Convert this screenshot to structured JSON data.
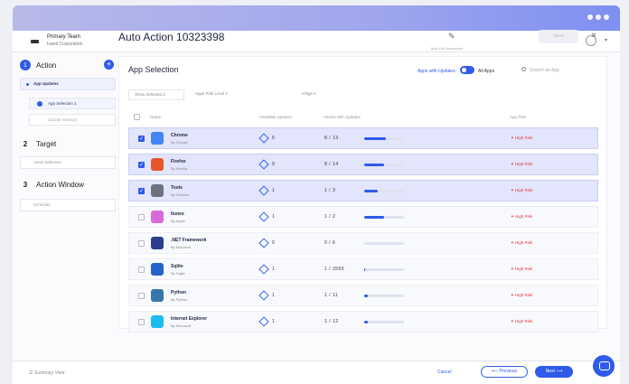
{
  "header": {
    "team_name": "Primary Team",
    "team_org": "Ivanti Corporation"
  },
  "sidebar": {
    "steps": [
      {
        "num": "1",
        "label": "Action"
      },
      {
        "num": "2",
        "label": "Target"
      },
      {
        "num": "3",
        "label": "Action Window"
      }
    ],
    "plus": "+",
    "sub_app_updates": "App Updates",
    "sub_app_selection": "App Selection 1",
    "sub_update_settings": "Update Settings",
    "sub_asset_selection": "Asset Selection",
    "sub_schedule": "Schedule"
  },
  "main": {
    "title": "Auto Action 10323398",
    "max_note": "Max 128 characters",
    "save_label": "Save",
    "close": "×"
  },
  "panel": {
    "title": "App Selection",
    "toggle_label": "Apps with Updates",
    "all_apps": "All Apps",
    "search_placeholder": "Search an App",
    "filters": {
      "show_selected": "Show Selected 3",
      "risk_level": "Apps Risk Level",
      "tags": "vTags"
    },
    "columns": {
      "name": "Name",
      "updates": "Available Updates",
      "assets": "Assets with Updates",
      "risk": "App Risk"
    }
  },
  "rows": [
    {
      "name": "Chrome",
      "by": "By Google",
      "updates": "5",
      "assets": "8  /  13",
      "fill": 0.55,
      "risk": "✦ High Risk",
      "selected": true,
      "color": "#4285f4"
    },
    {
      "name": "Firefox",
      "by": "By Mozilla",
      "updates": "9",
      "assets": "8  /  14",
      "fill": 0.5,
      "risk": "✦ High Risk",
      "selected": true,
      "color": "#e8562b"
    },
    {
      "name": "Tools",
      "by": "By Vmware",
      "updates": "1",
      "assets": "1  /  3",
      "fill": 0.35,
      "risk": "✦ High Risk",
      "selected": true,
      "color": "#6b7280"
    },
    {
      "name": "Itunes",
      "by": "By Apple",
      "updates": "1",
      "assets": "1  /  2",
      "fill": 0.5,
      "risk": "✦ High Risk",
      "selected": false,
      "color": "#d86ad8"
    },
    {
      "name": ".NET Framework",
      "by": "By Microsoft",
      "updates": "0",
      "assets": "0  /  6",
      "fill": 0,
      "risk": "✦ High Risk",
      "selected": false,
      "color": "#2a3d8f"
    },
    {
      "name": "Sqlite",
      "by": "By Sqlite",
      "updates": "1",
      "assets": "1  /  3555",
      "fill": 0.03,
      "risk": "✦ High Risk",
      "selected": false,
      "color": "#2563c9"
    },
    {
      "name": "Python",
      "by": "By Python",
      "updates": "1",
      "assets": "1  /  11",
      "fill": 0.1,
      "risk": "✦ High Risk",
      "selected": false,
      "color": "#3776ab"
    },
    {
      "name": "Internet Explorer",
      "by": "By Microsoft",
      "updates": "1",
      "assets": "1  /  12",
      "fill": 0.08,
      "risk": "✦ High Risk",
      "selected": false,
      "color": "#1ebbee"
    }
  ],
  "footer": {
    "summary": "☰ Summary View",
    "cancel": "Cancel",
    "previous": "⟵ Previous",
    "next": "Next ⟶"
  }
}
